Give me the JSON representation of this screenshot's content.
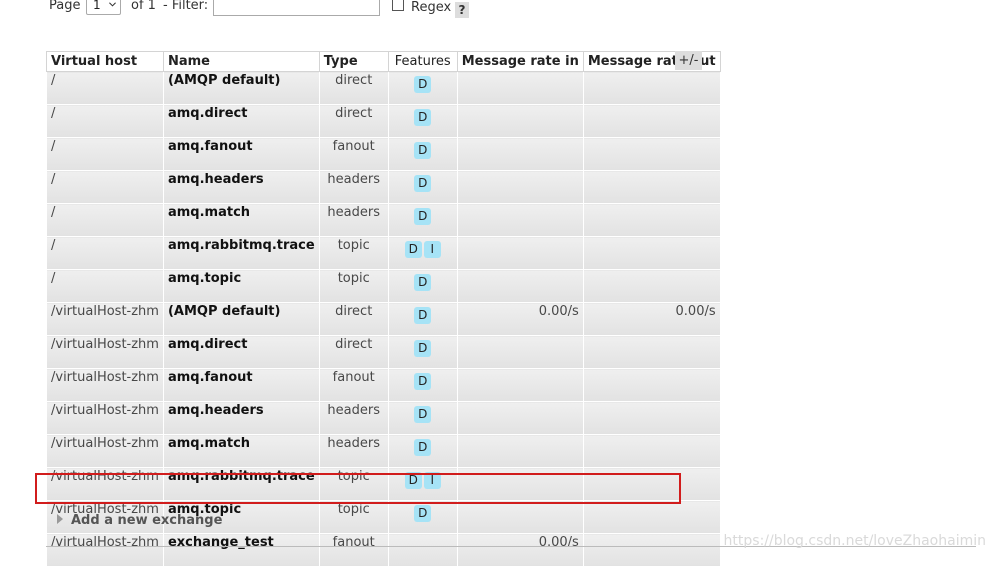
{
  "pager": {
    "page_label": "Page",
    "page_value": "1",
    "of_label": "of 1",
    "filter_label": "- Filter:",
    "filter_value": "",
    "regex_label": "Regex",
    "help_label": "?"
  },
  "table": {
    "headers": [
      "Virtual host",
      "Name",
      "Type",
      "Features",
      "Message rate in",
      "Message rate out"
    ],
    "toggle_label": "+/-",
    "rows": [
      {
        "vhost": "/",
        "name": "(AMQP default)",
        "type": "direct",
        "features": [
          "D"
        ],
        "rate_in": "",
        "rate_out": ""
      },
      {
        "vhost": "/",
        "name": "amq.direct",
        "type": "direct",
        "features": [
          "D"
        ],
        "rate_in": "",
        "rate_out": ""
      },
      {
        "vhost": "/",
        "name": "amq.fanout",
        "type": "fanout",
        "features": [
          "D"
        ],
        "rate_in": "",
        "rate_out": ""
      },
      {
        "vhost": "/",
        "name": "amq.headers",
        "type": "headers",
        "features": [
          "D"
        ],
        "rate_in": "",
        "rate_out": ""
      },
      {
        "vhost": "/",
        "name": "amq.match",
        "type": "headers",
        "features": [
          "D"
        ],
        "rate_in": "",
        "rate_out": ""
      },
      {
        "vhost": "/",
        "name": "amq.rabbitmq.trace",
        "type": "topic",
        "features": [
          "D",
          "I"
        ],
        "rate_in": "",
        "rate_out": ""
      },
      {
        "vhost": "/",
        "name": "amq.topic",
        "type": "topic",
        "features": [
          "D"
        ],
        "rate_in": "",
        "rate_out": ""
      },
      {
        "vhost": "/virtualHost-zhm",
        "name": "(AMQP default)",
        "type": "direct",
        "features": [
          "D"
        ],
        "rate_in": "0.00/s",
        "rate_out": "0.00/s"
      },
      {
        "vhost": "/virtualHost-zhm",
        "name": "amq.direct",
        "type": "direct",
        "features": [
          "D"
        ],
        "rate_in": "",
        "rate_out": ""
      },
      {
        "vhost": "/virtualHost-zhm",
        "name": "amq.fanout",
        "type": "fanout",
        "features": [
          "D"
        ],
        "rate_in": "",
        "rate_out": ""
      },
      {
        "vhost": "/virtualHost-zhm",
        "name": "amq.headers",
        "type": "headers",
        "features": [
          "D"
        ],
        "rate_in": "",
        "rate_out": ""
      },
      {
        "vhost": "/virtualHost-zhm",
        "name": "amq.match",
        "type": "headers",
        "features": [
          "D"
        ],
        "rate_in": "",
        "rate_out": ""
      },
      {
        "vhost": "/virtualHost-zhm",
        "name": "amq.rabbitmq.trace",
        "type": "topic",
        "features": [
          "D",
          "I"
        ],
        "rate_in": "",
        "rate_out": ""
      },
      {
        "vhost": "/virtualHost-zhm",
        "name": "amq.topic",
        "type": "topic",
        "features": [
          "D"
        ],
        "rate_in": "",
        "rate_out": ""
      },
      {
        "vhost": "/virtualHost-zhm",
        "name": "exchange_test",
        "type": "fanout",
        "features": [],
        "rate_in": "0.00/s",
        "rate_out": ""
      }
    ]
  },
  "add_exchange_label": "Add a new exchange",
  "watermark": "https://blog.csdn.net/loveZhaohaimin",
  "colors": {
    "badge": "#a6e3f6",
    "highlight": "#d11c1c",
    "row_bg": "#e8e8e8"
  }
}
